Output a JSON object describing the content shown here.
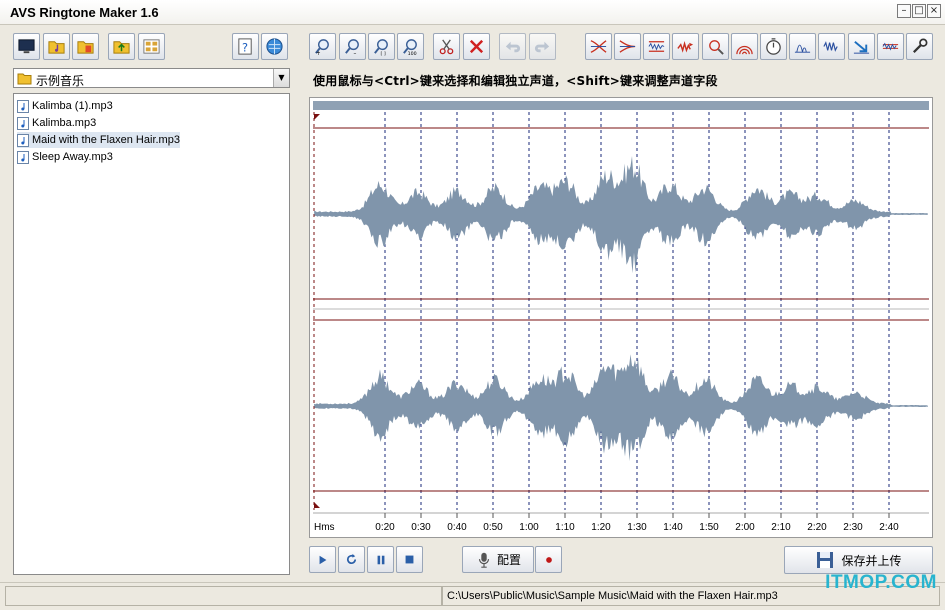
{
  "window": {
    "title": "AVS Ringtone Maker 1.6",
    "minimize": "–",
    "maximize": "□",
    "close": "×"
  },
  "left_panel": {
    "folder_select": {
      "value": "示例音乐"
    },
    "files": [
      {
        "name": "Kalimba (1).mp3",
        "selected": false
      },
      {
        "name": "Kalimba.mp3",
        "selected": false
      },
      {
        "name": "Maid with the Flaxen Hair.mp3",
        "selected": true
      },
      {
        "name": "Sleep Away.mp3",
        "selected": false
      }
    ]
  },
  "hint_text": "使用鼠标与<Ctrl>键来选择和编辑独立声道，<Shift>键来调整声道字段",
  "timeline": {
    "unit_label": "Hms",
    "ticks": [
      "0:20",
      "0:30",
      "0:40",
      "0:50",
      "1:00",
      "1:10",
      "1:20",
      "1:30",
      "1:40",
      "1:50",
      "2:00",
      "2:10",
      "2:20",
      "2:30",
      "2:40"
    ]
  },
  "playback": {
    "config_label": "配置",
    "save_label": "保存并上传"
  },
  "status": {
    "path": "C:\\Users\\Public\\Music\\Sample Music\\Maid with the Flaxen Hair.mp3"
  },
  "watermark": "ITMOP.COM",
  "colors": {
    "waveform": "#8095ab",
    "marker_line": "#7a1010",
    "grid_dash": "#1a2a78",
    "header_bar": "#8fa1b4"
  }
}
